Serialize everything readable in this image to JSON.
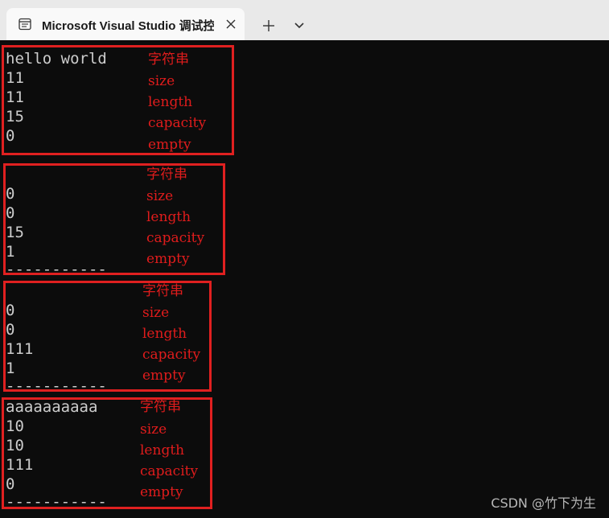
{
  "window": {
    "tab_title": "Microsoft Visual Studio 调试控",
    "tab_icon": "terminal-window-icon",
    "close_icon": "close-icon",
    "new_tab_icon": "plus-icon",
    "dropdown_icon": "chevron-down-icon"
  },
  "blocks": [
    {
      "output": [
        "hello world",
        "11",
        "11",
        "15",
        "0"
      ],
      "separator": "",
      "notes": [
        "字符串",
        "size",
        "length",
        "capacity",
        "empty"
      ]
    },
    {
      "output": [
        "",
        "0",
        "0",
        "15",
        "1"
      ],
      "separator": "-----------",
      "notes": [
        "字符串",
        "size",
        "length",
        "capacity",
        "empty"
      ]
    },
    {
      "output": [
        "",
        "0",
        "0",
        "111",
        "1"
      ],
      "separator": "-----------",
      "notes": [
        "字符串",
        "size",
        "length",
        "capacity",
        "empty"
      ]
    },
    {
      "output": [
        "aaaaaaaaaa",
        "10",
        "10",
        "111",
        "0"
      ],
      "separator": "-----------",
      "notes": [
        "字符串",
        "size",
        "length",
        "capacity",
        "empty"
      ]
    }
  ],
  "watermark": "CSDN @竹下为生",
  "colors": {
    "terminal_bg": "#0c0c0c",
    "terminal_text": "#cccccc",
    "annotation_red": "#e02020",
    "titlebar_bg": "#e9e9e9",
    "tab_bg": "#f9f9f9"
  }
}
